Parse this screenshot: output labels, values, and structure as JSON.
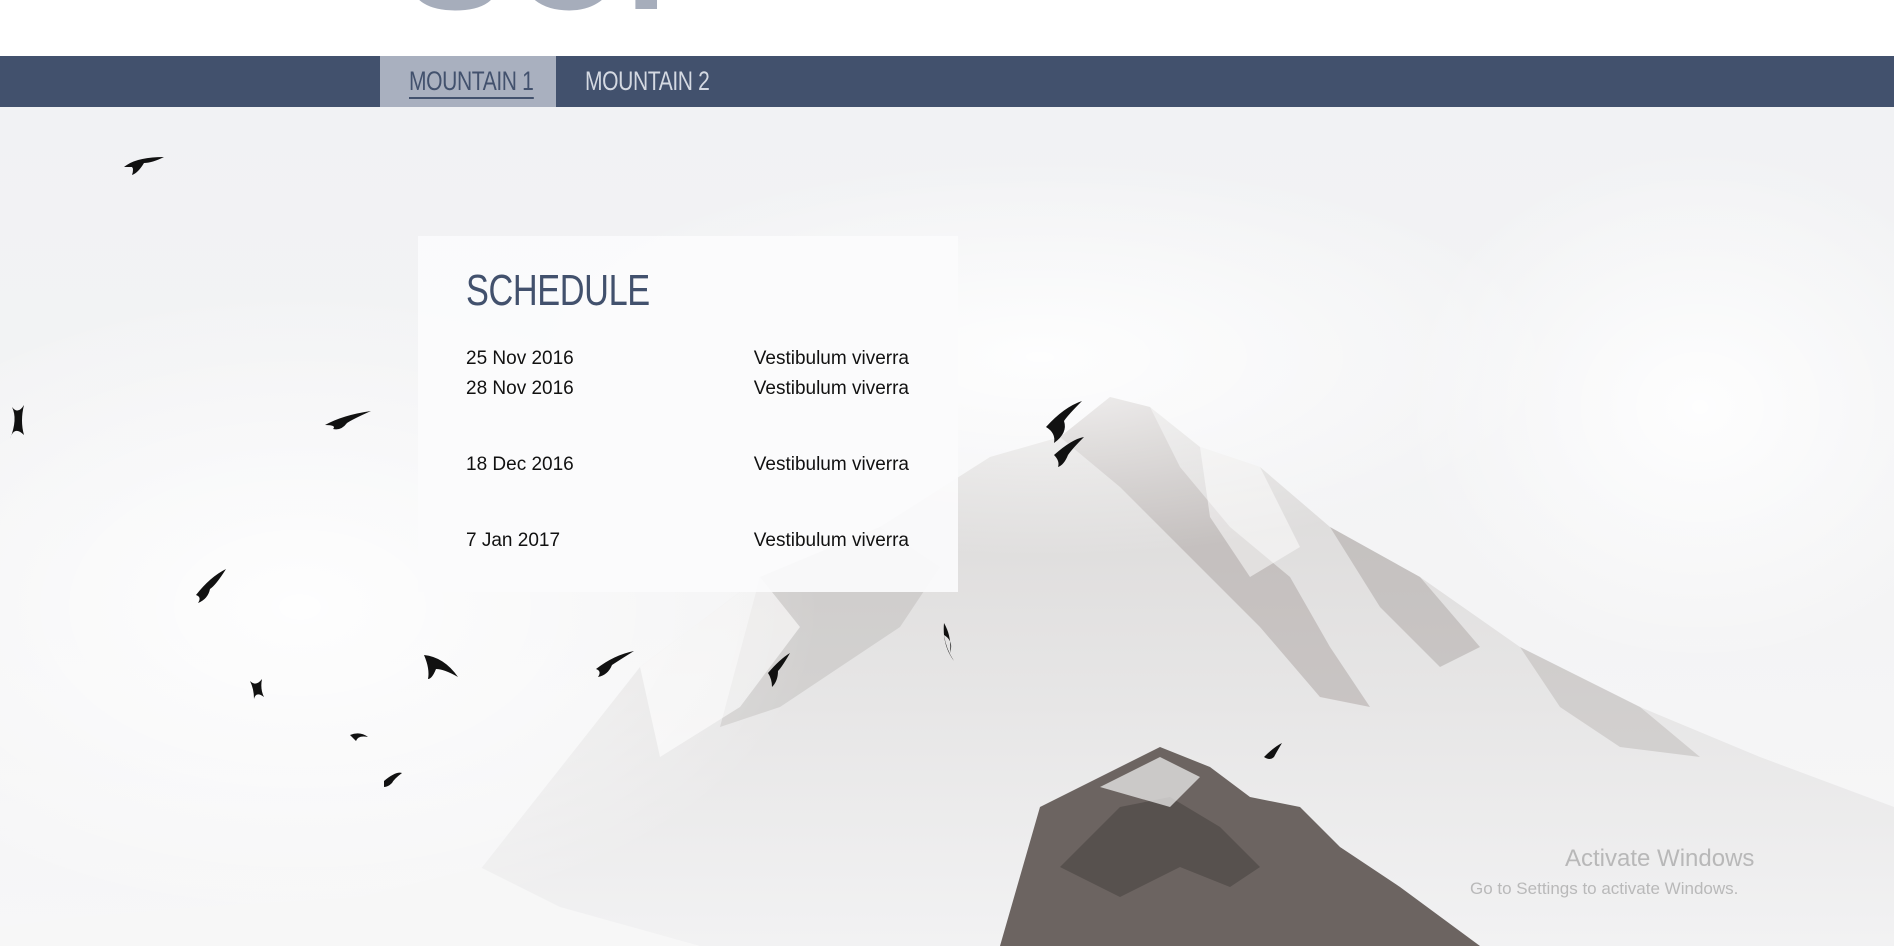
{
  "header": {
    "title_fragment": "SCI"
  },
  "nav": {
    "tabs": [
      {
        "label": "MOUNTAIN 1",
        "active": true
      },
      {
        "label": "MOUNTAIN 2",
        "active": false
      }
    ]
  },
  "schedule": {
    "title": "SCHEDULE",
    "rows": [
      {
        "date": "25 Nov 2016",
        "desc": "Vestibulum viverra"
      },
      {
        "date": "28 Nov 2016",
        "desc": "Vestibulum viverra"
      },
      {
        "date": "18 Dec 2016",
        "desc": "Vestibulum viverra"
      },
      {
        "date": "7 Jan 2017",
        "desc": "Vestibulum viverra"
      }
    ]
  },
  "watermark": {
    "line1": "Activate Windows",
    "line2": "Go to Settings to activate Windows."
  },
  "colors": {
    "nav_bg": "#42516d",
    "tab_active_bg": "#a9b0bf",
    "title_text": "#42516d"
  }
}
